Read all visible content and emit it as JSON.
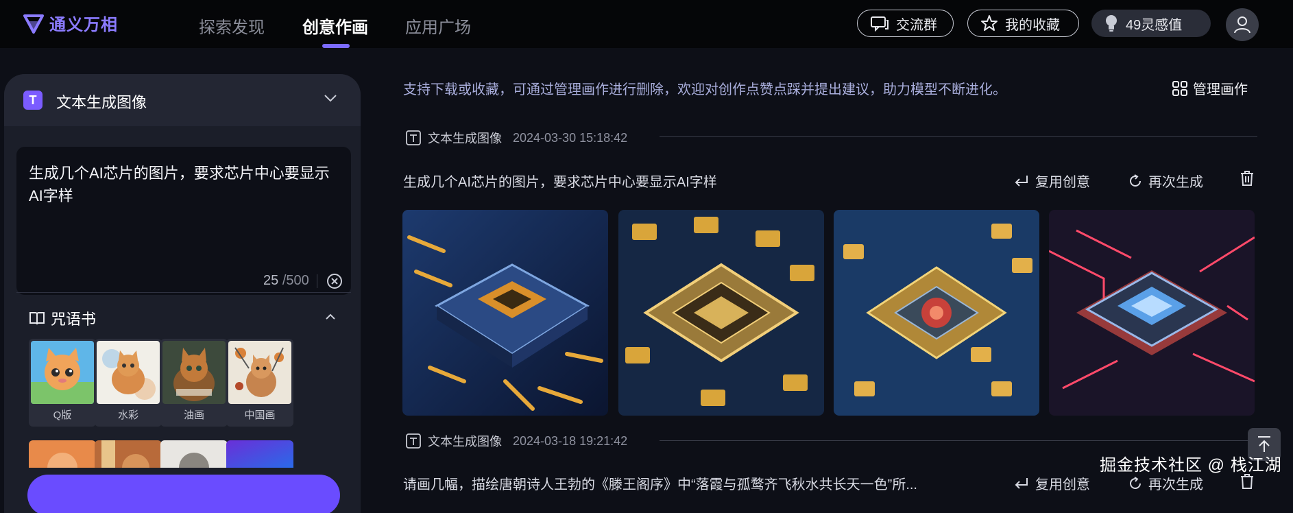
{
  "brand": {
    "name": "通义万相",
    "accent": "#7b6bff"
  },
  "nav": {
    "items": [
      "探索发现",
      "创意作画",
      "应用广场"
    ],
    "active": "创意作画"
  },
  "header_actions": {
    "community": "交流群",
    "favorites": "我的收藏",
    "credits": "49灵感值"
  },
  "left_panel": {
    "mode_title": "文本生成图像",
    "mode_badge": "T",
    "prompt": "生成几个AI芯片的图片，要求芯片中心要显示AI字样",
    "char_count": "25",
    "char_limit": "/500",
    "spell_book_title": "咒语书",
    "styles": [
      "Q版",
      "水彩",
      "油画",
      "中国画"
    ]
  },
  "content": {
    "notice": "支持下载或收藏，可通过管理画作进行删除，欢迎对创作点赞点踩并提出建议，助力模型不断进化。",
    "manage_label": "管理画作",
    "records": [
      {
        "type": "文本生成图像",
        "timestamp": "2024-03-30 15:18:42",
        "prompt": "生成几个AI芯片的图片，要求芯片中心要显示AI字样"
      },
      {
        "type": "文本生成图像",
        "timestamp": "2024-03-18 19:21:42",
        "prompt": "请画几幅，描绘唐朝诗人王勃的《滕王阁序》中“落霞与孤鹜齐飞秋水共长天一色”所..."
      }
    ],
    "actions": {
      "reuse": "复用创意",
      "regenerate": "再次生成"
    }
  },
  "watermark": "掘金技术社区 @ 栈江湖"
}
